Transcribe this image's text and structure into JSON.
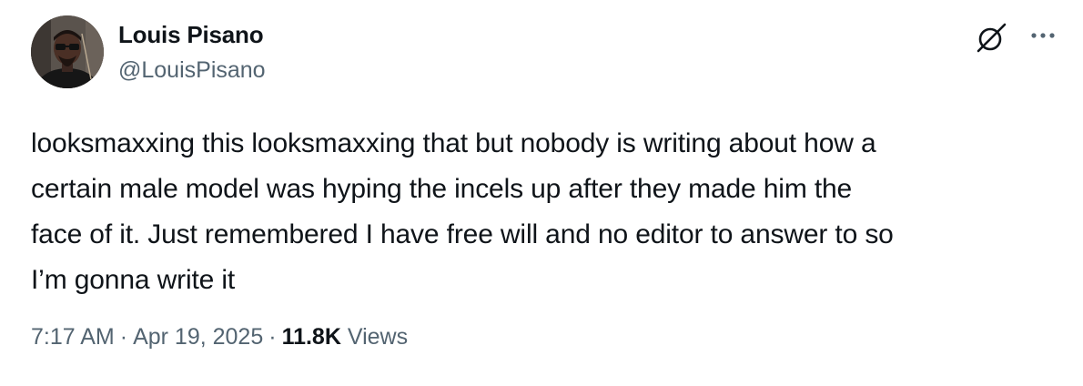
{
  "author": {
    "display_name": "Louis Pisano",
    "handle": "@LouisPisano",
    "avatar_icon": "profile-photo"
  },
  "header_icons": {
    "grok": "grok-icon",
    "more": "more-options-icon"
  },
  "tweet": {
    "text": "looksmaxxing this looksmaxxing that but nobody is writing about how a\ncertain male model was hyping the incels up after they made him the\nface of it. Just remembered I have free will and no editor to answer to so\nI’m gonna write it"
  },
  "meta": {
    "time": "7:17 AM",
    "separator": "·",
    "date": "Apr 19, 2025",
    "views_count": "11.8K",
    "views_label": "Views"
  },
  "colors": {
    "text_primary": "#0f1419",
    "text_secondary": "#536471",
    "background": "#ffffff"
  }
}
